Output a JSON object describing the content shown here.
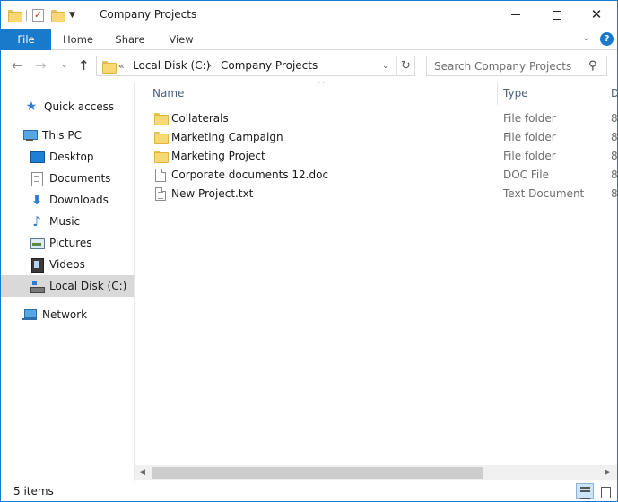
{
  "window": {
    "title": "Company Projects"
  },
  "ribbon": {
    "tabs": [
      {
        "label": "File"
      },
      {
        "label": "Home"
      },
      {
        "label": "Share"
      },
      {
        "label": "View"
      }
    ]
  },
  "navigation": {
    "address": {
      "overflow": "«",
      "parts": [
        "Local Disk (C:)",
        "Company Projects"
      ]
    },
    "search": {
      "placeholder": "Search Company Projects"
    }
  },
  "sidebar": {
    "items": [
      {
        "label": "Quick access",
        "icon": "quick-access-star-icon"
      },
      {
        "label": "This PC",
        "icon": "computer-icon"
      },
      {
        "label": "Desktop",
        "icon": "desktop-icon"
      },
      {
        "label": "Documents",
        "icon": "documents-icon"
      },
      {
        "label": "Downloads",
        "icon": "downloads-arrow-icon"
      },
      {
        "label": "Music",
        "icon": "music-note-icon"
      },
      {
        "label": "Pictures",
        "icon": "pictures-icon"
      },
      {
        "label": "Videos",
        "icon": "videos-film-icon"
      },
      {
        "label": "Local Disk (C:)",
        "icon": "local-disk-icon",
        "selected": true
      },
      {
        "label": "Network",
        "icon": "network-icon"
      }
    ]
  },
  "columns": {
    "name": "Name",
    "type": "Type",
    "date": "D"
  },
  "files": [
    {
      "name": "Collaterals",
      "type": "File folder",
      "date": "8,",
      "icon": "folder-icon"
    },
    {
      "name": "Marketing Campaign",
      "type": "File folder",
      "date": "8,",
      "icon": "folder-icon"
    },
    {
      "name": "Marketing Project",
      "type": "File folder",
      "date": "8,",
      "icon": "folder-icon"
    },
    {
      "name": "Corporate documents 12.doc",
      "type": "DOC File",
      "date": "8,",
      "icon": "doc-file-icon"
    },
    {
      "name": "New Project.txt",
      "type": "Text Document",
      "date": "8,",
      "icon": "text-file-icon"
    }
  ],
  "status": {
    "item_count": "5 items"
  },
  "colors": {
    "accent": "#1979ca",
    "selected": "#d9d9d9",
    "folder": "#f8d775"
  }
}
